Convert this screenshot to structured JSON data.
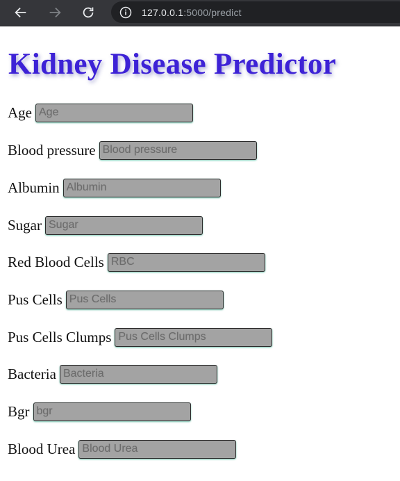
{
  "browser": {
    "url_host": "127.0.0.1",
    "url_path": ":5000/predict",
    "icons": {
      "back": "arrow-left",
      "forward": "arrow-right",
      "reload": "reload",
      "info": "info-circle"
    }
  },
  "page": {
    "title": "Kidney Disease Predictor",
    "title_color": "#3d22d6",
    "fields": [
      {
        "label": "Age",
        "placeholder": "Age"
      },
      {
        "label": "Blood pressure",
        "placeholder": "Blood pressure"
      },
      {
        "label": "Albumin",
        "placeholder": "Albumin"
      },
      {
        "label": "Sugar",
        "placeholder": "Sugar"
      },
      {
        "label": "Red Blood Cells",
        "placeholder": "RBC"
      },
      {
        "label": "Pus Cells",
        "placeholder": "Pus Cells"
      },
      {
        "label": "Pus Cells Clumps",
        "placeholder": "Pus Cells Clumps"
      },
      {
        "label": "Bacteria",
        "placeholder": "Bacteria"
      },
      {
        "label": "Bgr",
        "placeholder": "bgr"
      },
      {
        "label": "Blood Urea",
        "placeholder": "Blood Urea"
      }
    ]
  }
}
